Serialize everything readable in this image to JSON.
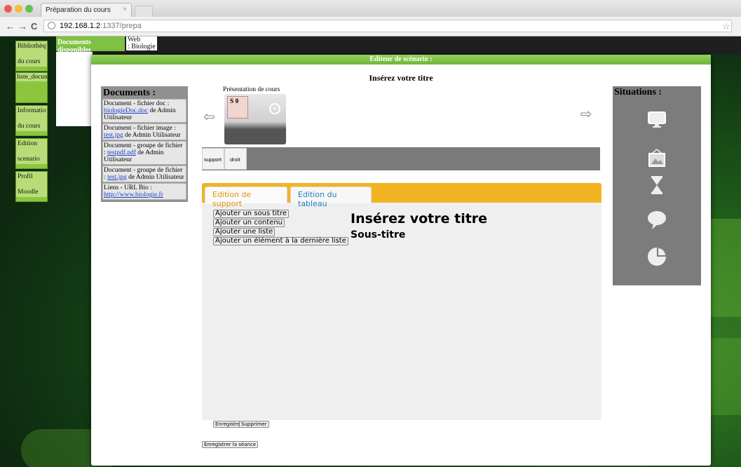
{
  "browser": {
    "tab_title": "Préparation du cours",
    "tab_close": "×",
    "url_host": "192.168.1.2",
    "url_rest": ":1337/prepa"
  },
  "nav": {
    "items": [
      {
        "label_lines": [
          "Bibliothèque",
          "du cours"
        ]
      },
      {
        "label_lines": [
          "liste_documents"
        ]
      },
      {
        "label_lines": [
          "Informations",
          "du cours"
        ]
      },
      {
        "label_lines": [
          "Edition",
          "scenario"
        ]
      },
      {
        "label_lines": [
          "Profil",
          "Moodle"
        ]
      }
    ],
    "docs_dispo": "Documents disponibles",
    "web_line1": "Web",
    "web_line2": ": Biologie"
  },
  "modal": {
    "header": "Editeur de scénario :",
    "title": "Insérez votre titre"
  },
  "documents": {
    "heading": "Documents :",
    "items": [
      {
        "prefix": "Document - fichier doc :",
        "link": "biologieDoc.doc",
        "suffix": " de Admin Utilisateur"
      },
      {
        "prefix": "Document - fichier image :",
        "link": "test.jpg",
        "suffix": " de Admin Utilisateur"
      },
      {
        "prefix": "Document - groupe de fichier :",
        "link": "testpdf.pdf",
        "suffix": " de Admin Utilisateur"
      },
      {
        "prefix": "Document - groupe de fichier :",
        "link": "test.jpg",
        "suffix": " de Admin Utilisateur"
      },
      {
        "prefix": "Liens - URL Bio :",
        "link": "http://www.biologie.fr",
        "suffix": ""
      }
    ]
  },
  "presentation": {
    "label": "Présentation de cours",
    "slide": "S 0",
    "plus": "+",
    "arrow_left": "⇦",
    "arrow_right": "⇨"
  },
  "layout_tabs": {
    "support": "support",
    "droit": "droit"
  },
  "editor": {
    "tab_support": "Edition de support",
    "tab_tableau": "Edition du tableau",
    "buttons": [
      "Ajouter un sous titre",
      "Ajouter un contenu",
      "Ajouter une liste",
      "Ajouter un élément à la dernière liste"
    ],
    "preview_title": "Insérez votre titre",
    "preview_subtitle": "Sous-titre"
  },
  "actions": {
    "save": "Enregistrer",
    "delete": "Supprimer",
    "save_session": "Enregistrer la séance"
  },
  "situations": {
    "heading": "Situations :",
    "icons": [
      "monitor-icon",
      "picture-frame-icon",
      "hourglass-icon",
      "speech-bubble-icon",
      "pie-chart-icon"
    ]
  },
  "colors": {
    "accent_green": "#7fc243",
    "accent_orange": "#f2b323",
    "tab_blue": "#1f7fc2"
  }
}
